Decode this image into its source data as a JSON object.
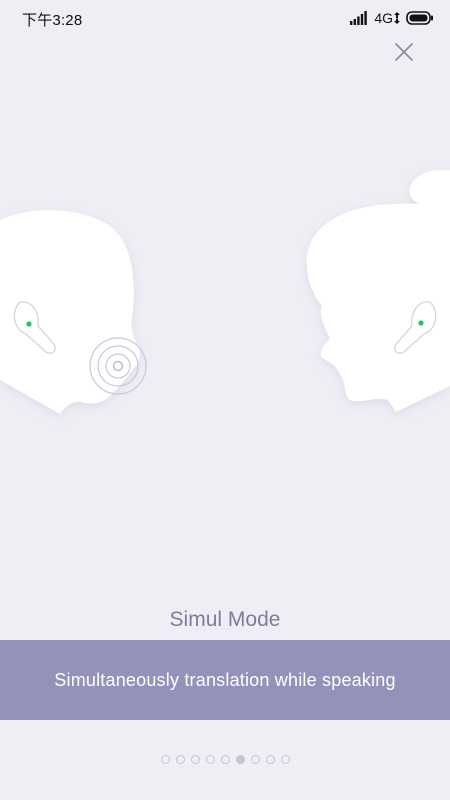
{
  "status_bar": {
    "time": "下午3:28",
    "network": "4G"
  },
  "mode": {
    "title": "Simul Mode",
    "description": "Simultaneously translation while speaking"
  },
  "pagination": {
    "total": 9,
    "active_index": 5
  },
  "colors": {
    "background": "#efeef5",
    "band": "#9592ba",
    "title": "#7f7c99",
    "earbud_led": "#22c55e"
  },
  "icons": {
    "close": "close-icon",
    "signal": "signal-icon",
    "battery": "battery-icon",
    "sound_waves": "sound-waves-icon"
  }
}
